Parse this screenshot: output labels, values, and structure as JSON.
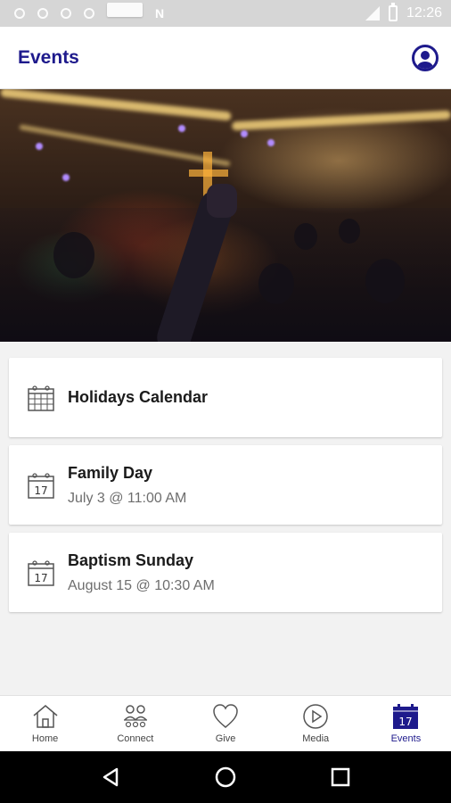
{
  "status_bar": {
    "time": "12:26",
    "icons": [
      "notification-icon",
      "notification-icon",
      "notification-icon",
      "notification-icon",
      "sim-card-icon",
      "n-logo-icon",
      "signal-icon",
      "battery-icon"
    ]
  },
  "app_bar": {
    "title": "Events",
    "profile_icon": "account-circle-icon"
  },
  "hero": {
    "image": "worship-crowd-photo"
  },
  "events": [
    {
      "title": "Holidays Calendar",
      "subtitle": "",
      "icon": "calendar-grid-icon"
    },
    {
      "title": "Family Day",
      "subtitle": "July 3 @ 11:00 AM",
      "icon": "calendar-day-icon",
      "day": "17"
    },
    {
      "title": "Baptism Sunday",
      "subtitle": "August 15 @ 10:30 AM",
      "icon": "calendar-day-icon",
      "day": "17"
    }
  ],
  "bottom_nav": {
    "items": [
      {
        "label": "Home",
        "icon": "home-icon",
        "active": false
      },
      {
        "label": "Connect",
        "icon": "people-icon",
        "active": false
      },
      {
        "label": "Give",
        "icon": "heart-icon",
        "active": false
      },
      {
        "label": "Media",
        "icon": "play-icon",
        "active": false
      },
      {
        "label": "Events",
        "icon": "calendar-icon",
        "active": true
      }
    ],
    "events_day": "17"
  },
  "system_nav": [
    "back-icon",
    "home-circle-icon",
    "recents-icon"
  ],
  "colors": {
    "accent": "#1e1a8c",
    "background": "#f2f2f2",
    "card": "#ffffff"
  }
}
